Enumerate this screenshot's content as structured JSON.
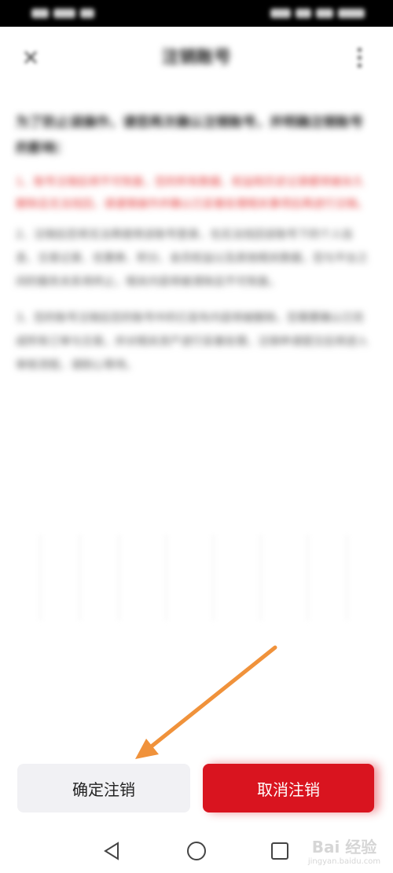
{
  "header": {
    "title": "注销账号"
  },
  "content": {
    "intro": "为了防止误操作，请您再次确认注销账号，并明确注销账号的影响：",
    "warning": "1、账号注销后将不可恢复，您的所有数据、权益和历史记录都将被永久删除且无法找回，请谨慎操作并确认已妥善处理相关事项后再进行注销。",
    "paragraphs": [
      "2、注销后您将无法再使用该账号登录，也无法找回该账号下的个人信息、交易记录、优惠券、积分、会员权益以及其他相关数据，您与平台之间的服务关系将终止，相关内容将被清除且不可恢复。",
      "3、您的账号注销后您的账号中的已发布内容将被删除，您需要确认已完成所有订单与交易，并对相关资产进行妥善处理，注销申请提交后将进入审核流程，请耐心等待。"
    ]
  },
  "buttons": {
    "confirm": "确定注销",
    "cancel": "取消注销"
  },
  "watermark": {
    "logo": "Bai 经验",
    "sub": "jingyan.baidu.com"
  },
  "colors": {
    "accent_red": "#d9141f",
    "warning_text": "#e33a3a",
    "annotation_arrow": "#f0923b"
  }
}
